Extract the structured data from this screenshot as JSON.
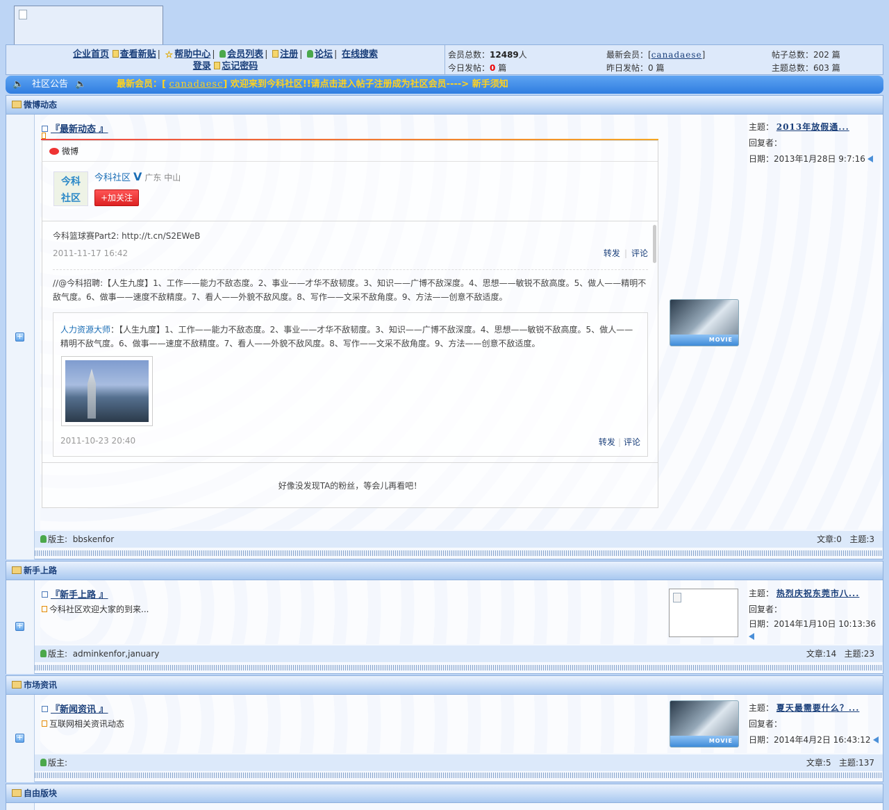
{
  "nav": {
    "links": [
      "企业首页",
      "查看新贴",
      "帮助中心",
      "会员列表",
      "注册",
      "论坛",
      "在线搜索"
    ],
    "links2": [
      "登录",
      "忘记密码"
    ]
  },
  "stats": {
    "members_label": "会员总数：",
    "members_value": "12489",
    "members_unit": "人",
    "newest_label": "最新会员：",
    "newest_value": "canadaese",
    "posts_label": "帖子总数：",
    "posts_value": "202",
    "posts_unit": "篇",
    "today_label": "今日发帖：",
    "today_value": "0",
    "today_unit": "篇",
    "yesterday_label": "昨日发帖：",
    "yesterday_value": "0",
    "yesterday_unit": "篇",
    "topics_label": "主题总数：",
    "topics_value": "603",
    "topics_unit": "篇"
  },
  "notice": {
    "label": "社区公告",
    "prefix": "最新会员：",
    "member": "canadaesc",
    "text": "欢迎来到今科社区!!请点击进入帖子注册成为社区会员----> ",
    "link": "新手须知"
  },
  "sections": [
    {
      "header": "微博动态",
      "forum_title": "『最新动态 』",
      "last": {
        "topic_label": "主题：",
        "topic": "2013年放假通...",
        "replier_label": "回复者：",
        "replier": "",
        "date_label": "日期：",
        "date": "2013年1月28日 9:7:16"
      },
      "mod_label": "版主:",
      "mod_value": "bbskenfor",
      "articles": "文章:0",
      "topics": "主题:3",
      "image_badge": "MOVIE"
    },
    {
      "header": "新手上路",
      "forum_title": "『新手上路 』",
      "desc": "今科社区欢迎大家的到来...",
      "last": {
        "topic_label": "主题：",
        "topic": "热烈庆祝东莞市八...",
        "replier_label": "回复者：",
        "replier": "",
        "date_label": "日期：",
        "date": "2014年1月10日 10:13:36"
      },
      "mod_label": "版主:",
      "mod_value": "adminkenfor,january",
      "articles": "文章:14",
      "topics": "主题:23"
    },
    {
      "header": "市场资讯",
      "forum_title": "『新闻资讯 』",
      "desc": "互联网相关资讯动态",
      "last": {
        "topic_label": "主题：",
        "topic": "夏天最需要什么？...",
        "replier_label": "回复者：",
        "replier": "",
        "date_label": "日期：",
        "date": "2014年4月2日 16:43:12"
      },
      "mod_label": "版主:",
      "mod_value": "",
      "articles": "文章:5",
      "topics": "主题:137",
      "image_badge": "MOVIE"
    },
    {
      "header": "自由版块"
    }
  ],
  "weibo": {
    "brand": "微博",
    "avatar_line1": "今科",
    "avatar_line2": "社区",
    "name": "今科社区",
    "verified": "V",
    "location": "广东 中山",
    "follow": "+加关注",
    "post1_text": "今科篮球赛Part2: http://t.cn/S2EWeB",
    "post1_time": "2011-11-17 16:42",
    "repost": "转发",
    "comment": "评论",
    "post2_text": "//@今科招聘:【人生九度】1、工作——能力不敌态度。2、事业——才华不敌韧度。3、知识——广博不敌深度。4、思想——敏锐不敌高度。5、做人——精明不敌气度。6、做事——速度不敌精度。7、看人——外貌不敌风度。8、写作——文采不敌角度。9、方法——创意不敌适度。",
    "quote_name": "人力资源大师",
    "quote_text": "：【人生九度】1、工作——能力不敌态度。2、事业——才华不敌韧度。3、知识——广博不敌深度。4、思想——敏锐不敌高度。5、做人——精明不敌气度。6、做事——速度不敌精度。7、看人——外貌不敌风度。8、写作——文采不敌角度。9、方法——创意不敌适度。",
    "quote_time": "2011-10-23 20:40",
    "footer": "好像没发现TA的粉丝，等会儿再看吧！"
  }
}
